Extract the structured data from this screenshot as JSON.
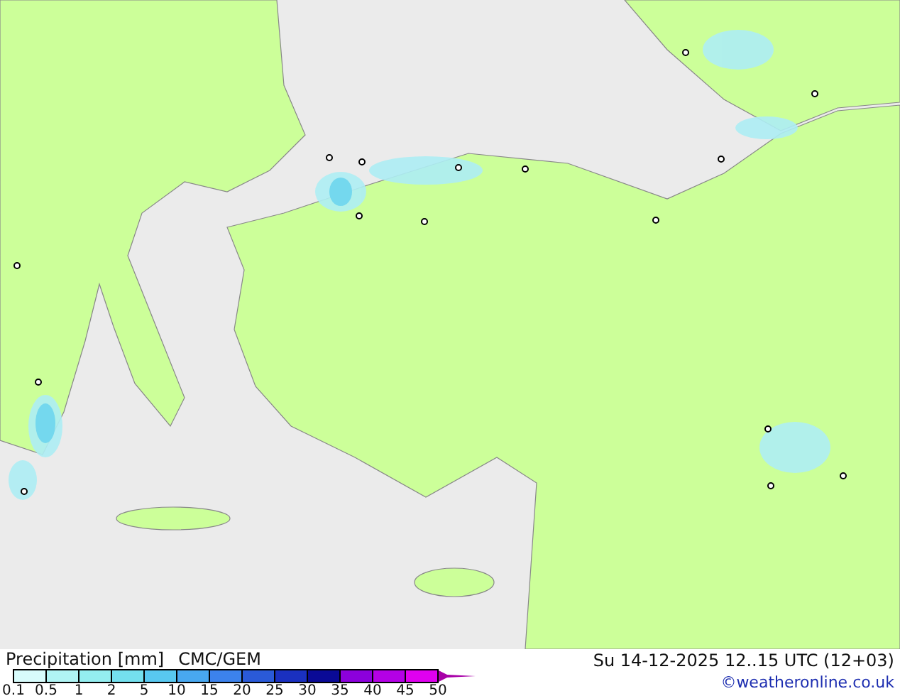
{
  "legend": {
    "title": "Precipitation [mm]",
    "model": "CMC/GEM",
    "valid_time": "Su 14-12-2025 12..15 UTC (12+03)",
    "credit": "©weatheronline.co.uk",
    "swatches": [
      {
        "color": "#d8fcfc"
      },
      {
        "color": "#b0f4f4"
      },
      {
        "color": "#94eef0"
      },
      {
        "color": "#74e0ee"
      },
      {
        "color": "#58c8f0"
      },
      {
        "color": "#48a8f0"
      },
      {
        "color": "#3c82ec"
      },
      {
        "color": "#2a5ad8"
      },
      {
        "color": "#1a30c0"
      },
      {
        "color": "#0a0a96"
      },
      {
        "color": "#8c00dc"
      },
      {
        "color": "#b400e6"
      },
      {
        "color": "#e000f0"
      },
      {
        "color": "#a800a8"
      }
    ],
    "ticks": [
      "0.1",
      "0.5",
      "1",
      "2",
      "5",
      "10",
      "15",
      "20",
      "25",
      "30",
      "35",
      "40",
      "45",
      "50"
    ]
  }
}
